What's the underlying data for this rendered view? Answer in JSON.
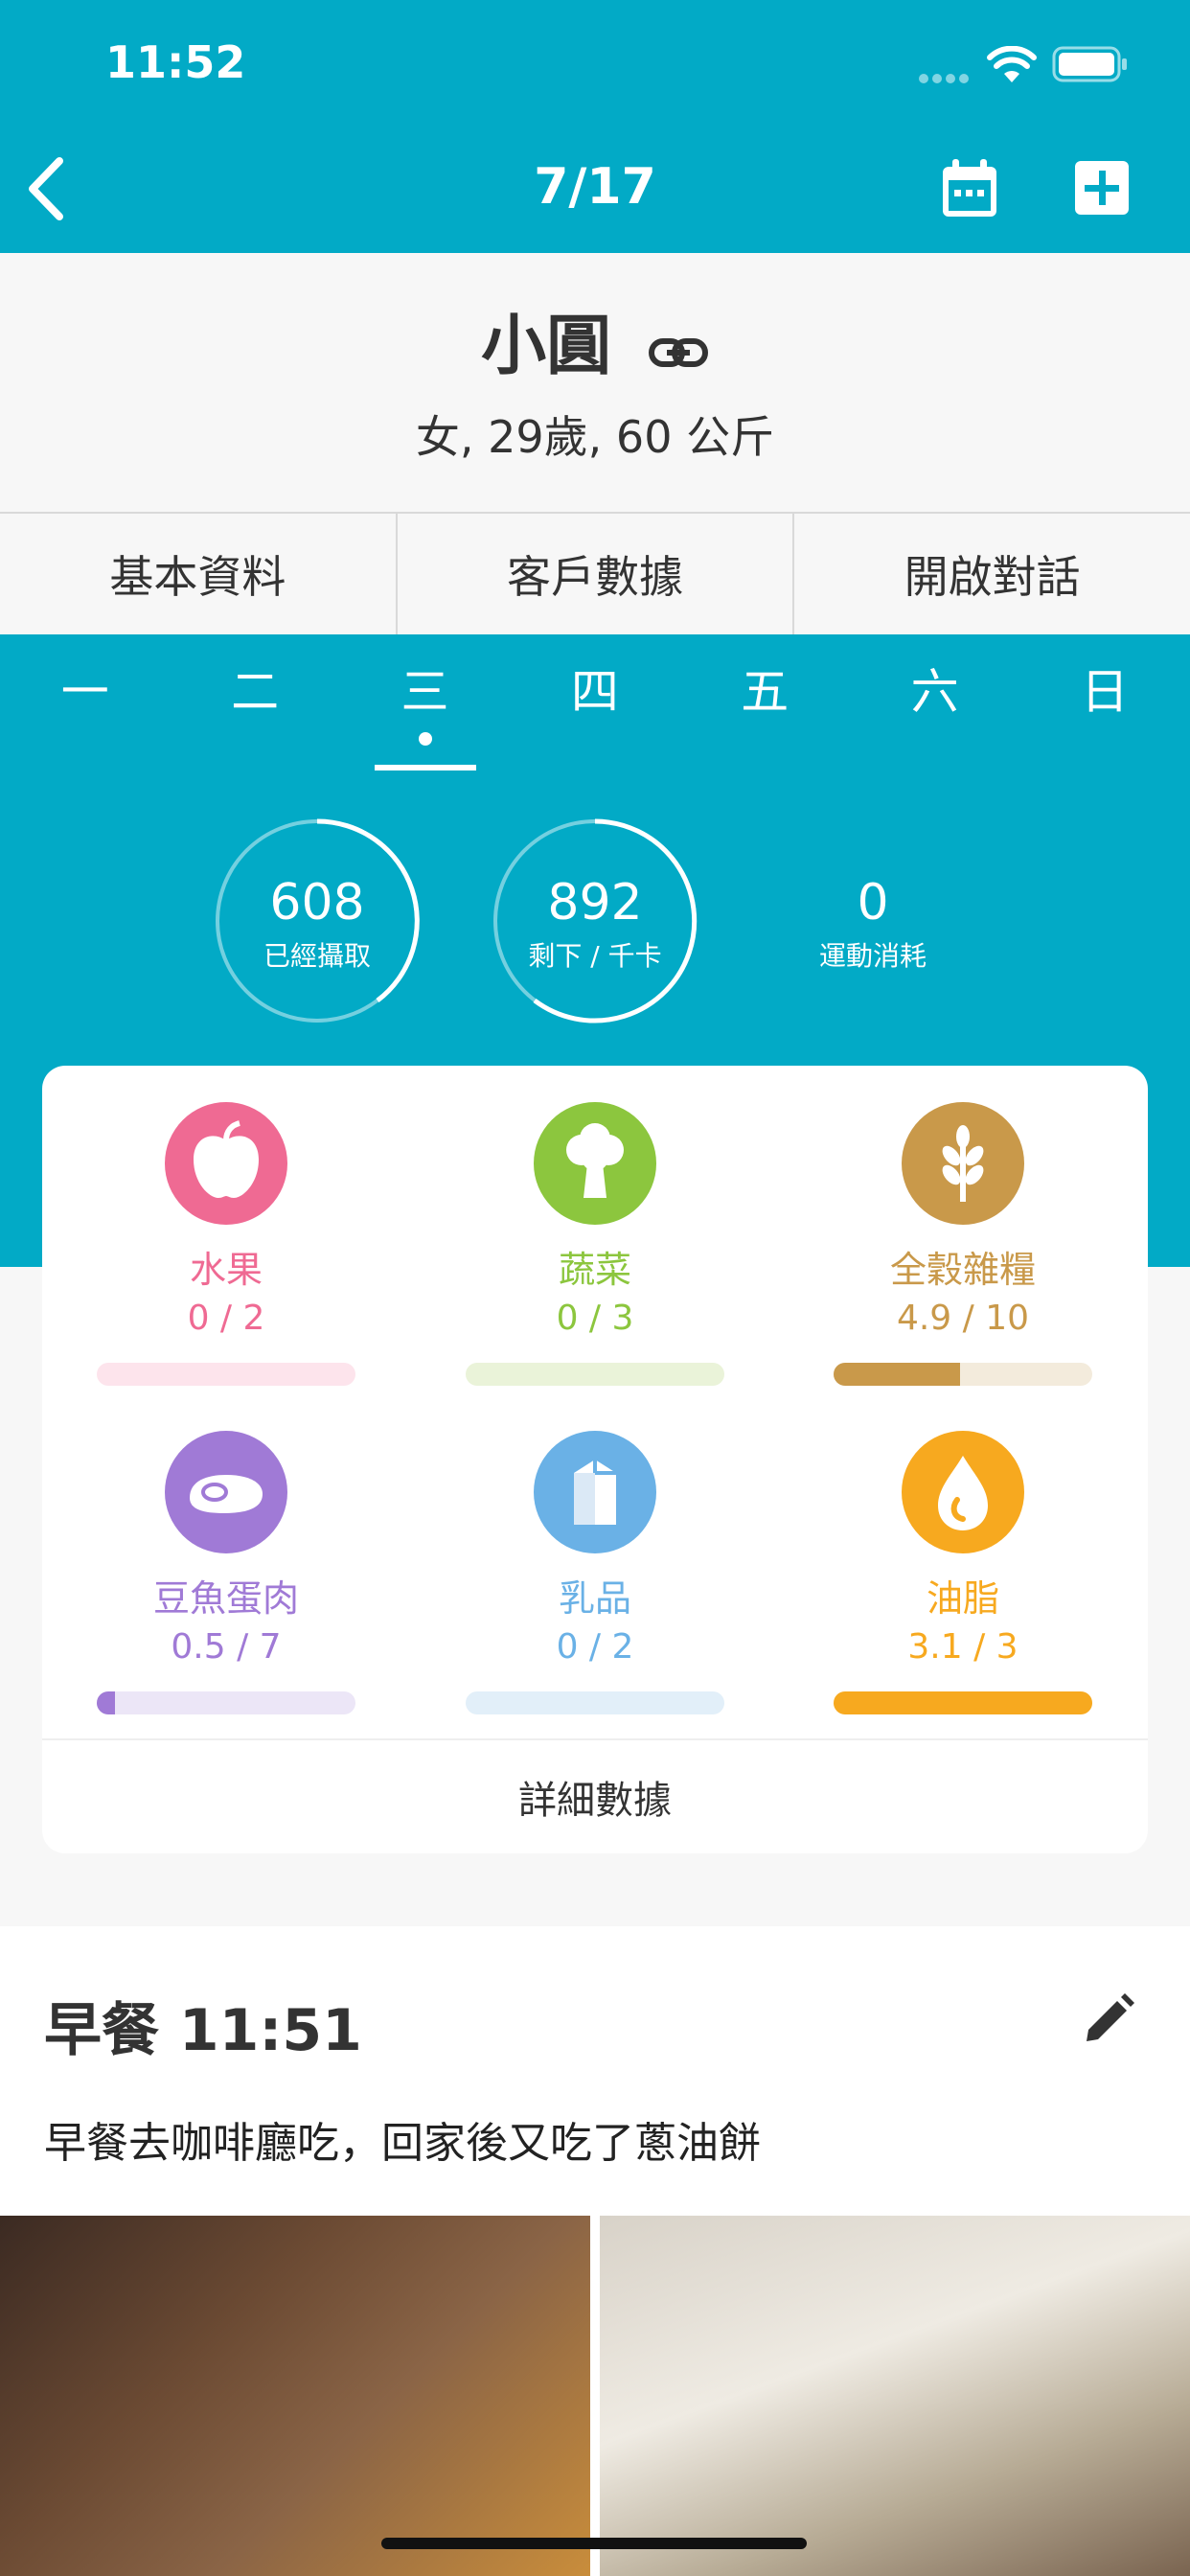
{
  "status_bar": {
    "time": "11:52"
  },
  "nav": {
    "date": "7/17"
  },
  "client": {
    "name": "小圓",
    "details": "女, 29歲, 60 公斤"
  },
  "tabs": [
    "基本資料",
    "客戶數據",
    "開啟對話"
  ],
  "weekdays": [
    "一",
    "二",
    "三",
    "四",
    "五",
    "六",
    "日"
  ],
  "selected_day": "三",
  "stats": {
    "consumed": {
      "value": "608",
      "label": "已經攝取"
    },
    "remaining": {
      "value": "892",
      "label": "剩下 / 千卡"
    },
    "exercise": {
      "value": "0",
      "label": "運動消耗"
    }
  },
  "food_groups": [
    {
      "name": "水果",
      "value": "0 / 2",
      "progress": 0,
      "color": "#ef6a93",
      "track": "#fde4ec",
      "icon": "apple-icon"
    },
    {
      "name": "蔬菜",
      "value": "0 / 3",
      "progress": 0,
      "color": "#8cc63e",
      "track": "#eaf3d9",
      "icon": "broccoli-icon"
    },
    {
      "name": "全穀雜糧",
      "value": "4.9 / 10",
      "progress": 0.49,
      "color": "#c9994a",
      "track": "#f3ebdc",
      "icon": "grain-icon"
    },
    {
      "name": "豆魚蛋肉",
      "value": "0.5 / 7",
      "progress": 0.07,
      "color": "#a07ad6",
      "track": "#ece6f7",
      "icon": "meat-icon"
    },
    {
      "name": "乳品",
      "value": "0 / 2",
      "progress": 0,
      "color": "#6ab1e6",
      "track": "#e2eff9",
      "icon": "milk-carton-icon"
    },
    {
      "name": "油脂",
      "value": "3.1 / 3",
      "progress": 1,
      "color": "#f7a91f",
      "track": "#fdefd2",
      "icon": "oil-drop-icon"
    }
  ],
  "detail_link": "詳細數據",
  "meal": {
    "title": "早餐 11:51",
    "description": "早餐去咖啡廳吃，回家後又吃了蔥油餅"
  }
}
